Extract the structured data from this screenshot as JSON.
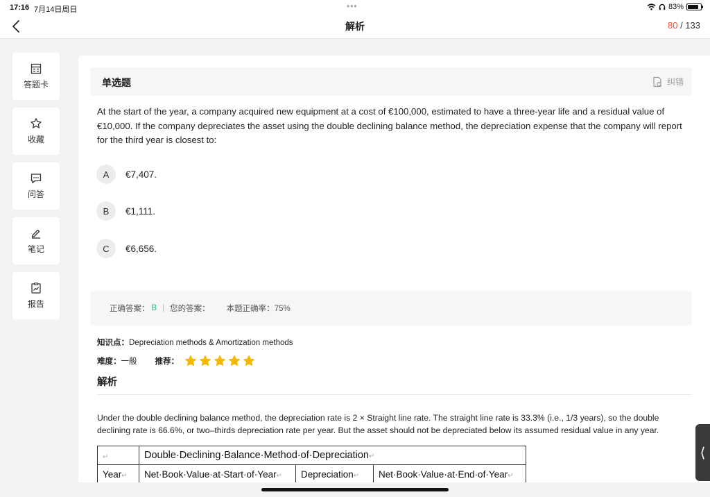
{
  "status": {
    "time": "17:16",
    "date": "7月14日周日",
    "battery": "83%",
    "battery_level": 0.83
  },
  "nav": {
    "title": "解析",
    "current": "80",
    "total": "/ 133"
  },
  "sidebar": [
    {
      "label": "答题卡",
      "icon": "answer-sheet-icon"
    },
    {
      "label": "收藏",
      "icon": "star-outline-icon"
    },
    {
      "label": "问答",
      "icon": "chat-icon"
    },
    {
      "label": "笔记",
      "icon": "pen-icon"
    },
    {
      "label": "报告",
      "icon": "report-icon"
    }
  ],
  "question": {
    "type": "单选题",
    "report_label": "纠错",
    "text": "At the start of the year, a company acquired new equipment at a cost of €100,000, estimated to have a three-year life and a residual value of €10,000. If the company depreciates the asset using the double declining balance method, the depreciation expense that the company will report for the third year is closest to:",
    "options": [
      {
        "letter": "A",
        "text": "€7,407."
      },
      {
        "letter": "B",
        "text": "€1,111."
      },
      {
        "letter": "C",
        "text": "€6,656."
      }
    ]
  },
  "answer": {
    "correct_label": "正确答案：",
    "correct_value": "B",
    "separator": "|",
    "your_label": "您的答案：",
    "rate_label": "本题正确率：75%"
  },
  "knowledge": {
    "label": "知识点：",
    "value": "Depreciation methods & Amortization methods"
  },
  "difficulty": {
    "label": "难度：",
    "value": "一般",
    "recommend_label": "推荐：",
    "stars": 5,
    "star_color": "#f5b800"
  },
  "analysis": {
    "title": "解析",
    "text": "Under the double declining balance method, the depreciation rate is 2 × Straight line rate. The straight line rate is 33.3% (i.e., 1/3 years), so the double declining rate is 66.6%, or two–thirds depreciation rate per year. But the asset should not be depreciated below its assumed residual value in any year.",
    "table": {
      "title": "Double·Declining·Balance·Method·of·Depreciation",
      "headers": [
        "Year",
        "Net·Book·Value·at·Start·of·Year",
        "Depreciation",
        "Net·Book·Value·at·End·of·Year"
      ],
      "return_mark": "↵"
    }
  },
  "colors": {
    "accent": "#e8563c",
    "correct": "#2bb673"
  }
}
